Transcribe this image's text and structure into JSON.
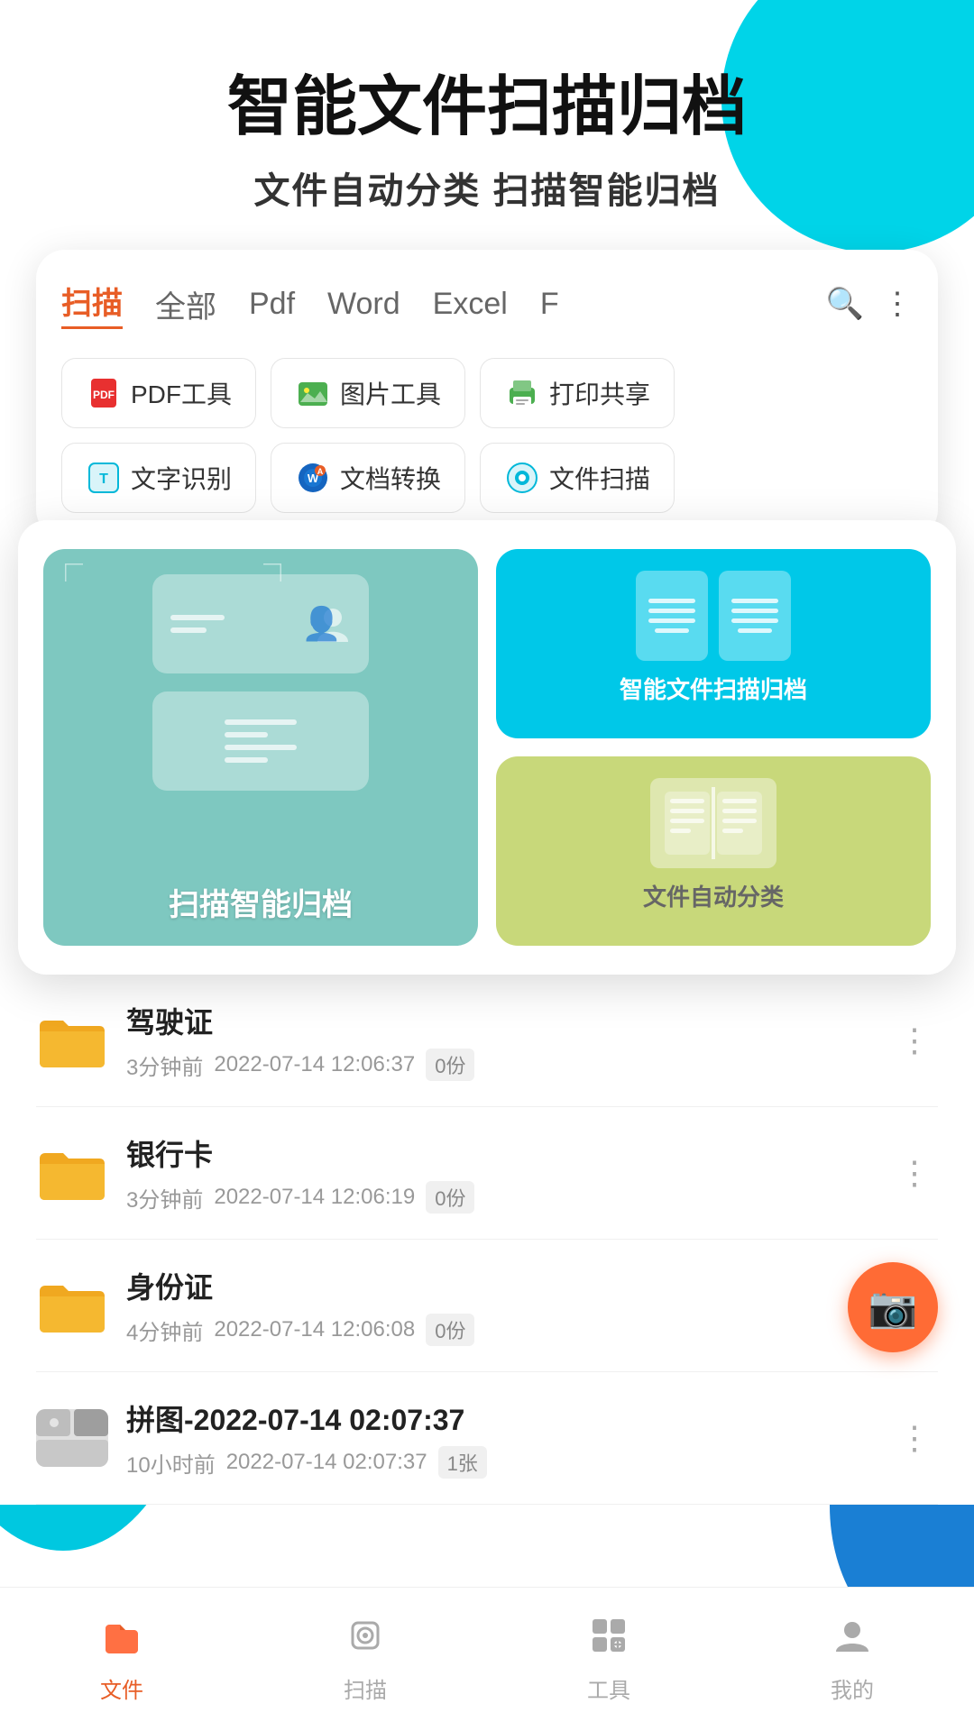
{
  "hero": {
    "title": "智能文件扫描归档",
    "subtitle": "文件自动分类  扫描智能归档"
  },
  "tabs": {
    "items": [
      {
        "label": "扫描",
        "active": true
      },
      {
        "label": "全部",
        "active": false
      },
      {
        "label": "Pdf",
        "active": false
      },
      {
        "label": "Word",
        "active": false
      },
      {
        "label": "Excel",
        "active": false
      },
      {
        "label": "F",
        "active": false
      }
    ]
  },
  "tools": {
    "row1": [
      {
        "icon": "📄",
        "label": "PDF工具"
      },
      {
        "icon": "🖼",
        "label": "图片工具"
      },
      {
        "icon": "🖨",
        "label": "打印共享"
      }
    ],
    "row2": [
      {
        "icon": "T",
        "label": "文字识别"
      },
      {
        "icon": "W",
        "label": "文档转换"
      },
      {
        "icon": "🔵",
        "label": "文件扫描"
      }
    ]
  },
  "features": {
    "left": {
      "label": "扫描智能归档"
    },
    "right_top": {
      "label": "智能文件扫描归档"
    },
    "right_bottom": {
      "label": "文件自动分类"
    }
  },
  "files": [
    {
      "name": "驾驶证",
      "time": "3分钟前",
      "date": "2022-07-14 12:06:37",
      "badge": "0份",
      "type": "folder"
    },
    {
      "name": "银行卡",
      "time": "3分钟前",
      "date": "2022-07-14 12:06:19",
      "badge": "0份",
      "type": "folder"
    },
    {
      "name": "身份证",
      "time": "4分钟前",
      "date": "2022-07-14 12:06:08",
      "badge": "0份",
      "type": "folder"
    },
    {
      "name": "拼图-2022-07-14 02:07:37",
      "time": "10小时前",
      "date": "2022-07-14 02:07:37",
      "badge": "1张",
      "type": "image"
    }
  ],
  "nav": {
    "items": [
      {
        "label": "文件",
        "active": true
      },
      {
        "label": "扫描",
        "active": false
      },
      {
        "label": "工具",
        "active": false
      },
      {
        "label": "我的",
        "active": false
      }
    ]
  }
}
